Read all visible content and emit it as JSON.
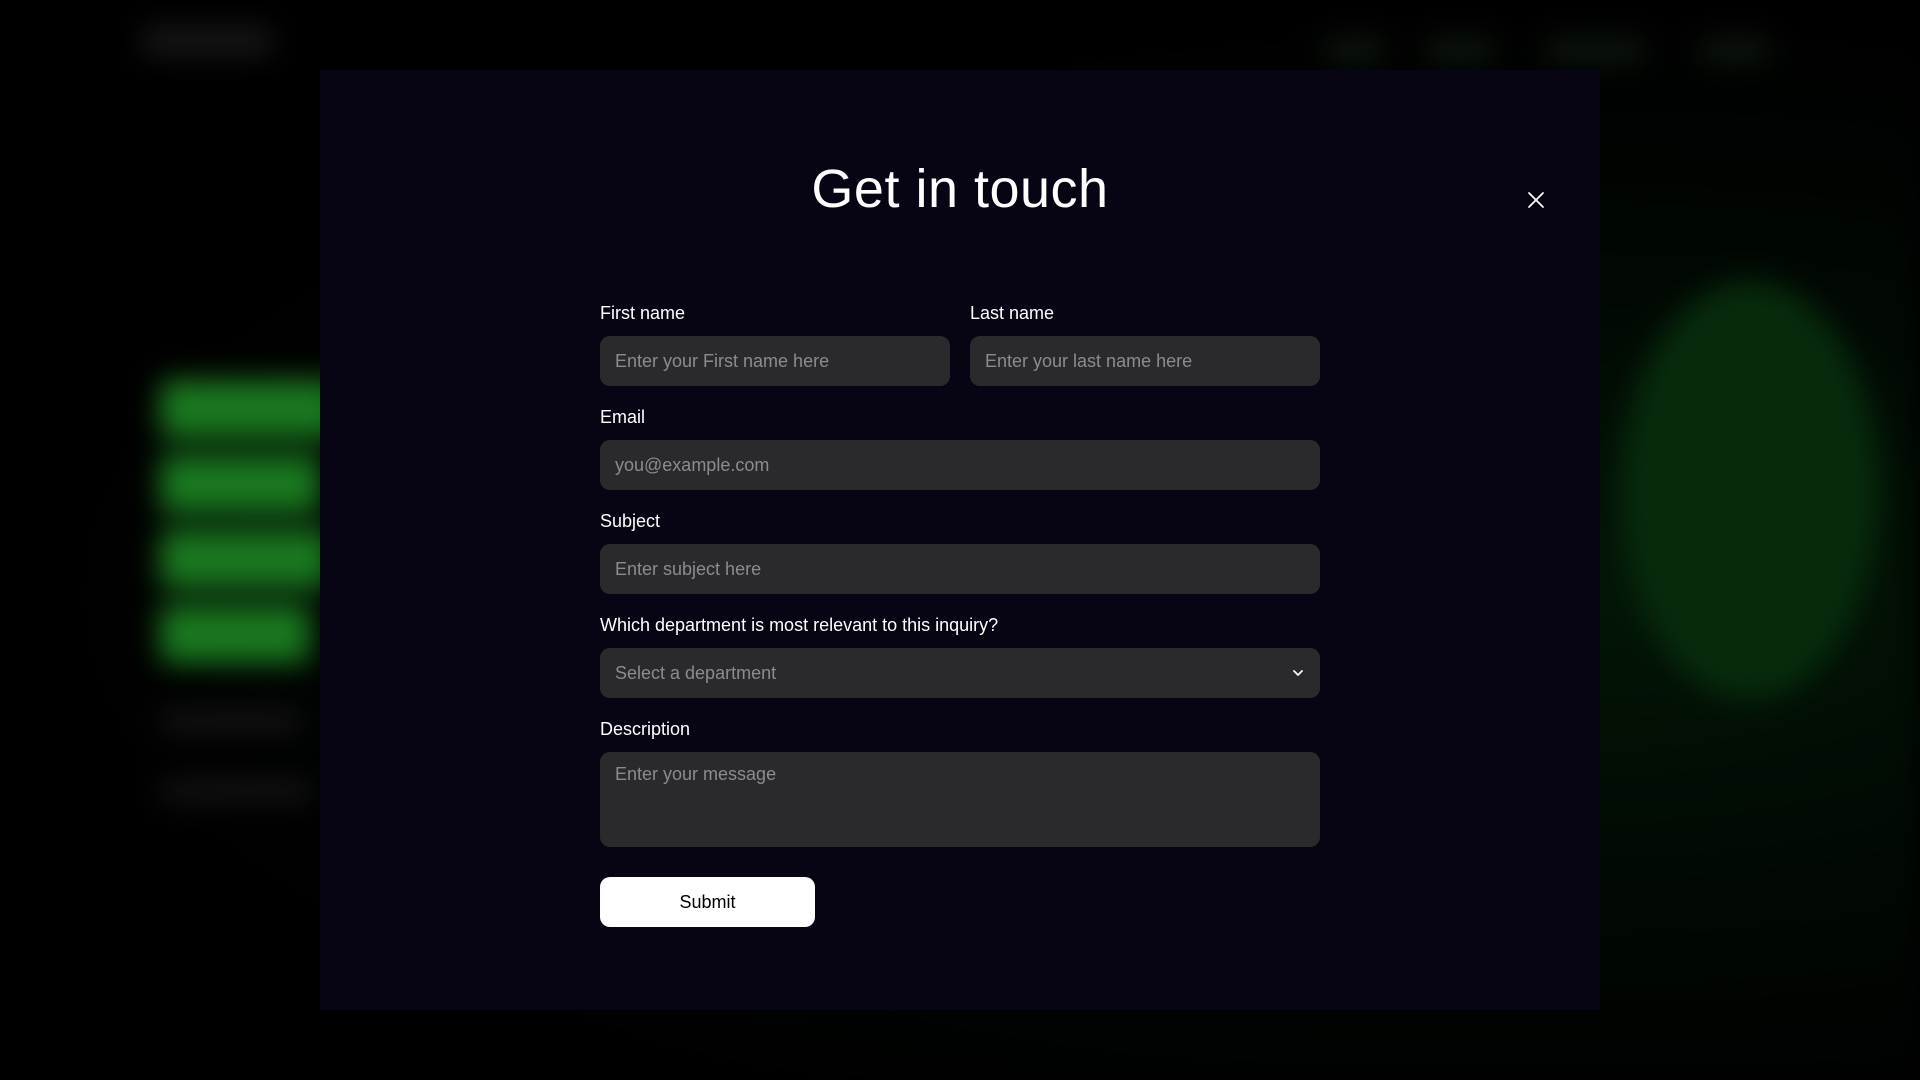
{
  "modal": {
    "title": "Get in touch",
    "close_icon": "close-icon",
    "fields": {
      "first_name": {
        "label": "First name",
        "placeholder": "Enter your First name here"
      },
      "last_name": {
        "label": "Last name",
        "placeholder": "Enter your last name here"
      },
      "email": {
        "label": "Email",
        "placeholder": "you@example.com"
      },
      "subject": {
        "label": "Subject",
        "placeholder": "Enter subject here"
      },
      "department": {
        "label": "Which department is most relevant to this inquiry?",
        "selected": "Select a department",
        "icon": "chevron-down-icon"
      },
      "description": {
        "label": "Description",
        "placeholder": "Enter your message"
      }
    },
    "submit_label": "Submit"
  },
  "colors": {
    "modal_bg": "#070513",
    "input_bg": "#2a2a2c",
    "placeholder": "#8c8c90",
    "text": "#ffffff",
    "button_bg": "#ffffff",
    "background_accent": "#2fdc3a"
  }
}
